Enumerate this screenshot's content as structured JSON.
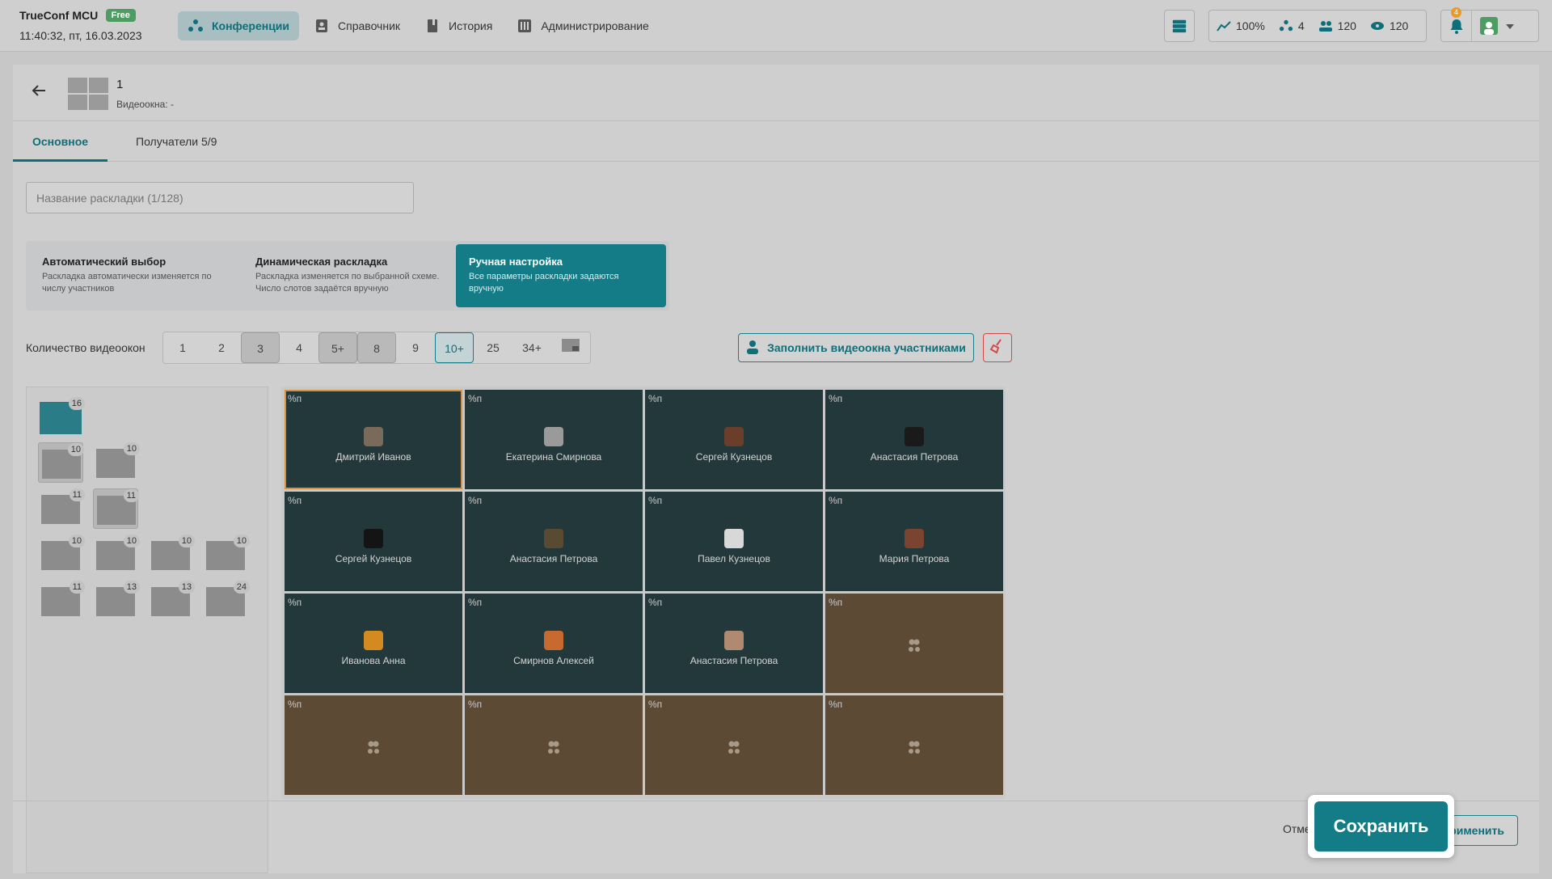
{
  "app": {
    "name": "TrueConf MCU",
    "badge": "Free",
    "datetime": "11:40:32, пт, 16.03.2023"
  },
  "nav": [
    {
      "label": "Конференции",
      "icon": "conference-icon",
      "active": true
    },
    {
      "label": "Справочник",
      "icon": "address-book-icon"
    },
    {
      "label": "История",
      "icon": "history-icon"
    },
    {
      "label": "Администрирование",
      "icon": "admin-icon"
    }
  ],
  "stats": {
    "load": "100%",
    "conferences": "4",
    "participants": "120",
    "viewers": "120",
    "notifications": "4"
  },
  "layout": {
    "title": "1",
    "windows_label": "Видеоокна: -"
  },
  "tabs": [
    {
      "label": "Основное"
    },
    {
      "label": "Получатели 5/9"
    }
  ],
  "name_input": {
    "placeholder": "Название раскладки (1/128)"
  },
  "modes": [
    {
      "title": "Автоматический выбор",
      "desc": "Раскладка автоматически изменяется по числу участников"
    },
    {
      "title": "Динамическая раскладка",
      "desc": "Раскладка изменяется по выбранной схеме. Число слотов задаётся вручную"
    },
    {
      "title": "Ручная настройка",
      "desc": "Все параметры раскладки задаются вручную"
    }
  ],
  "count_label": "Количество видеоокон",
  "counts": [
    "1",
    "2",
    "3",
    "4",
    "5+",
    "8",
    "9",
    "10+",
    "25",
    "34+"
  ],
  "fill_button": "Заполнить видеоокна участниками",
  "layout_counts": [
    "16",
    "10",
    "10",
    "11",
    "11",
    "10",
    "10",
    "10",
    "10",
    "11",
    "13",
    "13",
    "24"
  ],
  "slot_tag": "%п",
  "cells": [
    {
      "name": "Дмитрий Иванов",
      "color": "#7a6a5a"
    },
    {
      "name": "Екатерина Смирнова",
      "color": "#9a9a9a"
    },
    {
      "name": "Сергей Кузнецов",
      "color": "#6a3e2a"
    },
    {
      "name": "Анастасия Петрова",
      "color": "#1a1a1a"
    },
    {
      "name": "Сергей Кузнецов",
      "color": "#141414"
    },
    {
      "name": "Анастасия Петрова",
      "color": "#5a4a32"
    },
    {
      "name": "Павел Кузнецов",
      "color": "#d8d8d8"
    },
    {
      "name": "Мария Петрова",
      "color": "#7a4430"
    },
    {
      "name": "Иванова Анна",
      "color": "#d48a1e"
    },
    {
      "name": "Смирнов Алексей",
      "color": "#c86a30"
    },
    {
      "name": "Анастасия Петрова",
      "color": "#b08a70"
    },
    {
      "name": "",
      "color": ""
    },
    {
      "name": "",
      "color": ""
    },
    {
      "name": "",
      "color": ""
    },
    {
      "name": "",
      "color": ""
    },
    {
      "name": "",
      "color": ""
    }
  ],
  "footer": {
    "cancel": "Отме",
    "apply": "рименить",
    "save": "Сохранить"
  }
}
